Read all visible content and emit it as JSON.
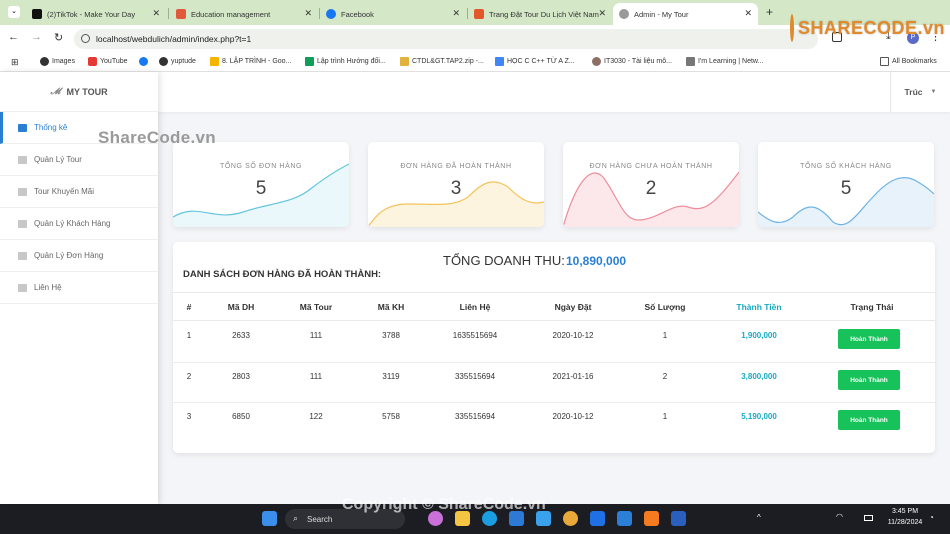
{
  "browser": {
    "tabs": [
      {
        "title": "(2)TikTok - Make Your Day",
        "color": "#111111"
      },
      {
        "title": "Education management",
        "color": "#e05b3c"
      },
      {
        "title": "Facebook",
        "color": "#1877f2"
      },
      {
        "title": "Trang Đặt Tour Du Lịch Việt Nam",
        "color": "#e2572c"
      },
      {
        "title": "Admin - My Tour",
        "color": "#888888"
      }
    ],
    "url": "localhost/webdulich/admin/index.php?t=1",
    "bookmarks": [
      "Images",
      "YouTube",
      "yuptude",
      "8. LẬP TRÌNH - Goo...",
      "Lập trình Hướng đối...",
      "CTDL&GT.TAP2.zip -...",
      "HỌC C C++ TỪ A Z...",
      "IT3030 - Tài liệu mô...",
      "I'm Learning | Netw...",
      "All Bookmarks"
    ]
  },
  "app": {
    "brand": "MY TOUR",
    "user": "Trúc",
    "nav": [
      {
        "label": "Thống kê",
        "active": true
      },
      {
        "label": "Quản Lý Tour",
        "active": false
      },
      {
        "label": "Tour Khuyến Mãi",
        "active": false
      },
      {
        "label": "Quản Lý Khách Hàng",
        "active": false
      },
      {
        "label": "Quản Lý Đơn Hàng",
        "active": false
      },
      {
        "label": "Liên Hệ",
        "active": false
      }
    ]
  },
  "stats": [
    {
      "label": "TỔNG SỐ ĐƠN HÀNG",
      "value": "5",
      "color": "#63c6dc"
    },
    {
      "label": "ĐƠN HÀNG ĐÃ HOÀN THÀNH",
      "value": "3",
      "color": "#f3c35a"
    },
    {
      "label": "ĐƠN HÀNG CHƯA HOÀN THÀNH",
      "value": "2",
      "color": "#ef8d9c"
    },
    {
      "label": "TỔNG SỐ KHÁCH HÀNG",
      "value": "5",
      "color": "#6fb3e6"
    }
  ],
  "revenue": {
    "label": "TỔNG DOANH THU:",
    "value": "10,890,000"
  },
  "orders": {
    "title": "DANH SÁCH ĐƠN HÀNG ĐÃ HOÀN THÀNH:",
    "columns": [
      "#",
      "Mã DH",
      "Mã Tour",
      "Mã KH",
      "Liên Hệ",
      "Ngày Đặt",
      "Số Lượng",
      "Thành Tiền",
      "Trạng Thái"
    ],
    "rows": [
      [
        "1",
        "2633",
        "111",
        "3788",
        "1635515694",
        "2020-10-12",
        "1",
        "1,900,000",
        "Hoàn Thành"
      ],
      [
        "2",
        "2803",
        "111",
        "3119",
        "335515694",
        "2021-01-16",
        "2",
        "3,800,000",
        "Hoàn Thành"
      ],
      [
        "3",
        "6850",
        "122",
        "5758",
        "335515694",
        "2020-10-12",
        "1",
        "5,190,000",
        "Hoàn Thành"
      ]
    ]
  },
  "watermarks": {
    "top": "ShareCode.vn",
    "logo": "SHARECODE.vn",
    "bottom": "Copyright © ShareCode.vn"
  },
  "taskbar": {
    "search": "Search",
    "time": "3:45 PM",
    "date": "11/28/2024"
  }
}
